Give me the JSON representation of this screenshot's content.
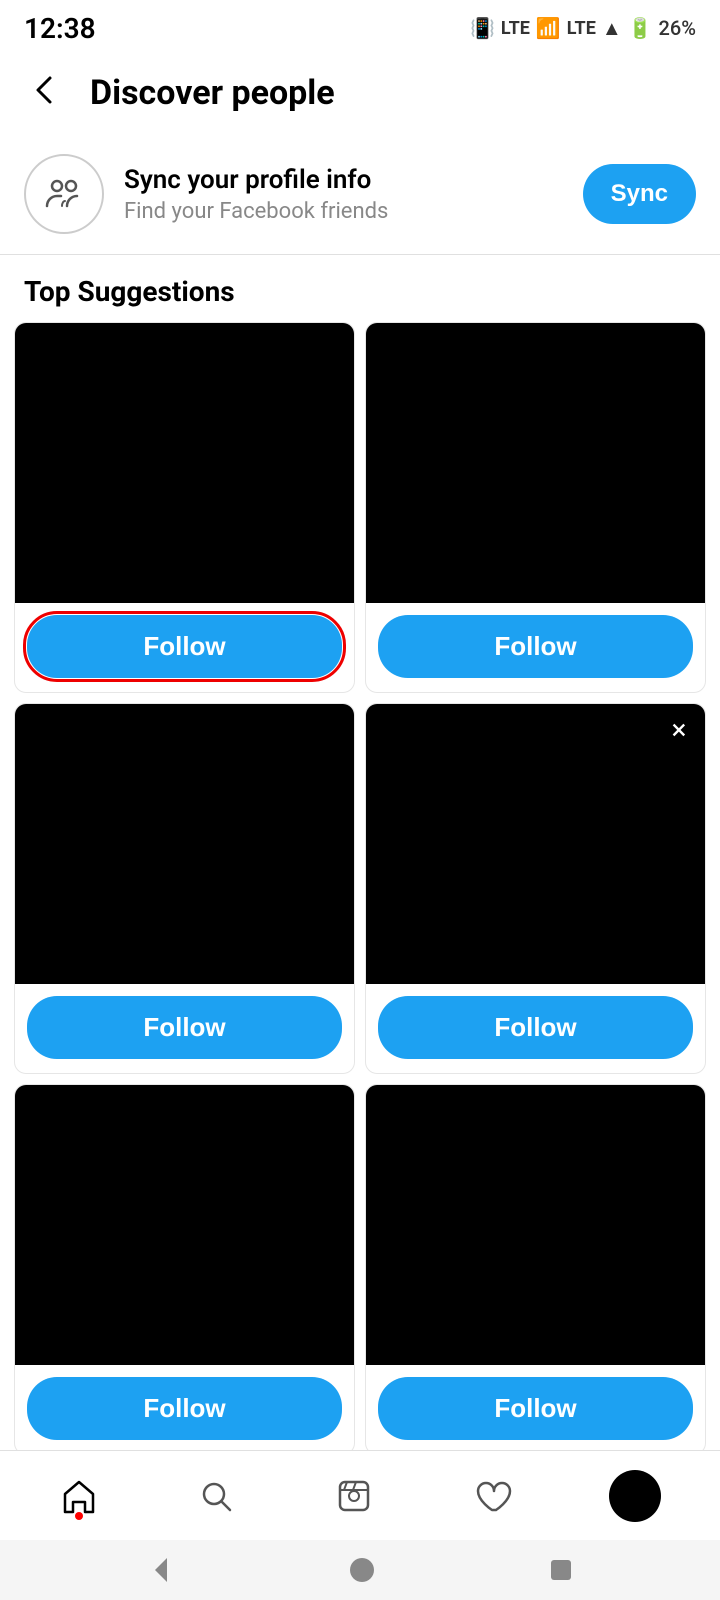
{
  "statusBar": {
    "time": "12:38",
    "battery": "26%"
  },
  "header": {
    "title": "Discover people",
    "backLabel": "←"
  },
  "sync": {
    "title": "Sync your profile info",
    "subtitle": "Find your Facebook friends",
    "buttonLabel": "Sync"
  },
  "suggestionsTitle": "Top Suggestions",
  "cards": [
    {
      "id": 1,
      "hasClose": false,
      "followLabel": "Follow",
      "highlighted": true
    },
    {
      "id": 2,
      "hasClose": false,
      "followLabel": "Follow",
      "highlighted": false
    },
    {
      "id": 3,
      "hasClose": false,
      "followLabel": "Follow",
      "highlighted": false
    },
    {
      "id": 4,
      "hasClose": true,
      "followLabel": "Follow",
      "highlighted": false
    },
    {
      "id": 5,
      "hasClose": false,
      "followLabel": "Follow",
      "highlighted": false
    },
    {
      "id": 6,
      "hasClose": false,
      "followLabel": "Follow",
      "highlighted": false
    }
  ],
  "nav": {
    "home": "Home",
    "search": "Search",
    "reels": "Reels",
    "activity": "Activity",
    "profile": "Profile"
  }
}
